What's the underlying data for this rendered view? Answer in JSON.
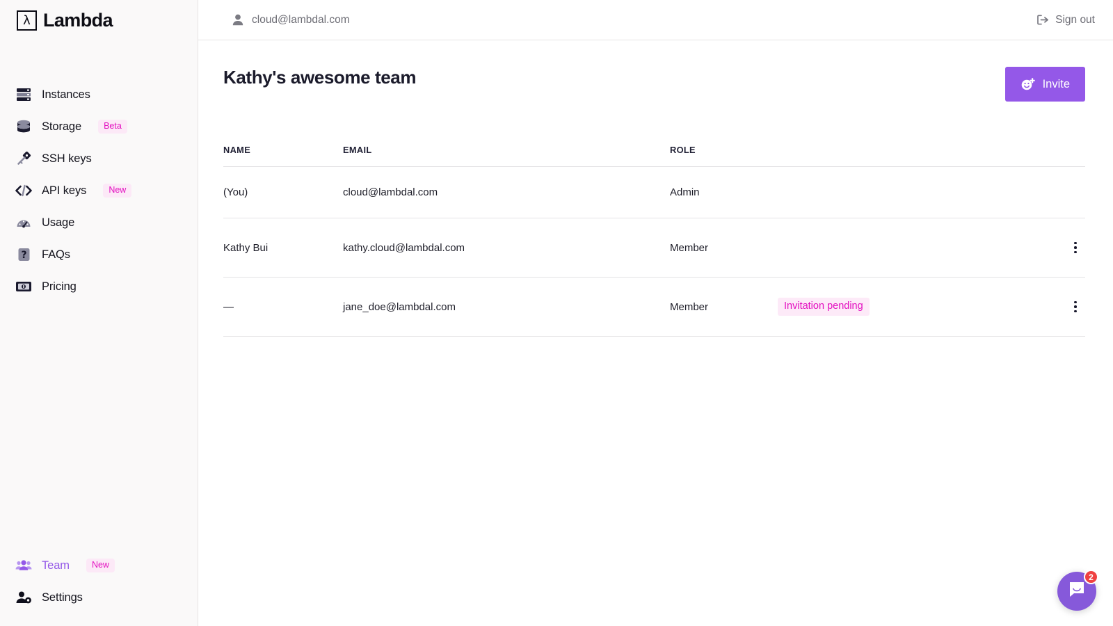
{
  "brand": {
    "name": "Lambda",
    "mark": "λ"
  },
  "sidebar": {
    "top_items": [
      {
        "label": "Instances",
        "icon": "server-icon",
        "badge": null,
        "active": false
      },
      {
        "label": "Storage",
        "icon": "database-icon",
        "badge": "Beta",
        "active": false
      },
      {
        "label": "SSH keys",
        "icon": "key-icon",
        "badge": null,
        "active": false
      },
      {
        "label": "API keys",
        "icon": "code-icon",
        "badge": "New",
        "active": false
      },
      {
        "label": "Usage",
        "icon": "gauge-icon",
        "badge": null,
        "active": false
      },
      {
        "label": "FAQs",
        "icon": "question-box-icon",
        "badge": null,
        "active": false
      },
      {
        "label": "Pricing",
        "icon": "banknote-icon",
        "badge": null,
        "active": false
      }
    ],
    "bottom_items": [
      {
        "label": "Team",
        "icon": "people-icon",
        "badge": "New",
        "active": true
      },
      {
        "label": "Settings",
        "icon": "user-gear-icon",
        "badge": null,
        "active": false
      }
    ]
  },
  "topbar": {
    "account_email": "cloud@lambdal.com",
    "account_icon": "user-icon",
    "signout_label": "Sign out",
    "signout_icon": "sign-out-icon"
  },
  "page": {
    "title": "Kathy's awesome team",
    "invite_label": "Invite",
    "invite_icon": "add-person-icon"
  },
  "table": {
    "columns": [
      "NAME",
      "EMAIL",
      "ROLE"
    ],
    "rows": [
      {
        "name": "(You)",
        "email": "cloud@lambdal.com",
        "role": "Admin",
        "status": "",
        "menu": false
      },
      {
        "name": "Kathy Bui",
        "email": "kathy.cloud@lambdal.com",
        "role": "Member",
        "status": "",
        "menu": true
      },
      {
        "name": "—",
        "email": "jane_doe@lambdal.com",
        "role": "Member",
        "status": "Invitation pending",
        "menu": true
      }
    ]
  },
  "intercom": {
    "count": "2",
    "icon": "chat-bubble-icon"
  },
  "colors": {
    "accent_purple": "#9458e8",
    "badge_pink_bg": "#fce9f7",
    "badge_pink_text": "#e310c0",
    "intercom_purple": "#8659da",
    "intercom_badge_red": "#f04141",
    "sidebar_bg": "#faf9f9",
    "border": "#e4e3e5"
  }
}
